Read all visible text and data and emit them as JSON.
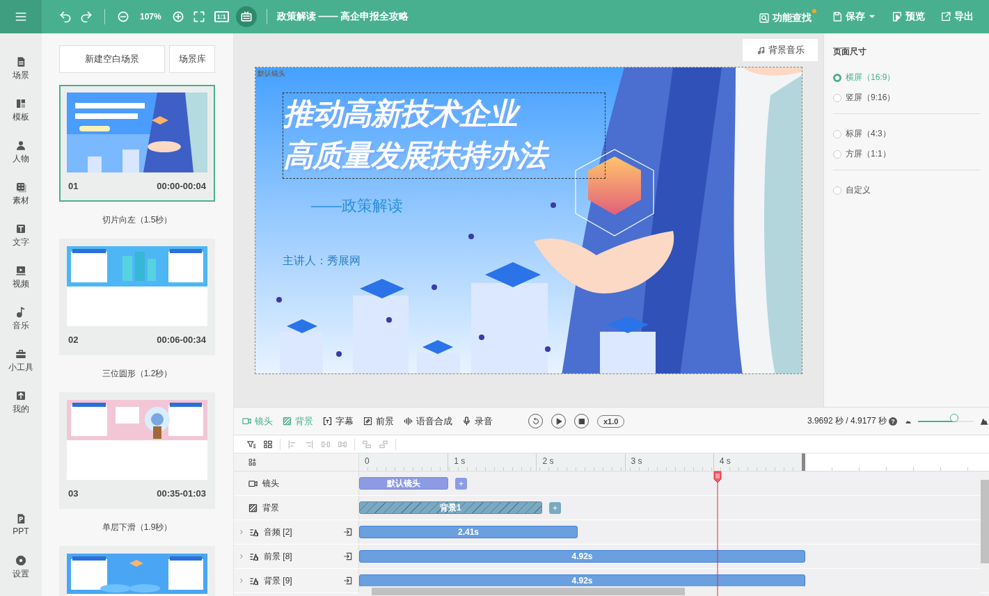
{
  "top_bar": {
    "zoom": "107%",
    "actual_size": "1:1",
    "caption_tool_on": true,
    "title": "政策解读 —— 高企申报全攻略",
    "actions": [
      {
        "label": "功能查找",
        "badge": true,
        "dropdown": false
      },
      {
        "label": "保存",
        "badge": false,
        "dropdown": true
      },
      {
        "label": "预览",
        "badge": false,
        "dropdown": false
      },
      {
        "label": "导出",
        "badge": false,
        "dropdown": false
      }
    ]
  },
  "nav": {
    "items": [
      {
        "label": "场景"
      },
      {
        "label": "模板"
      },
      {
        "label": "人物"
      },
      {
        "label": "素材"
      },
      {
        "label": "文字"
      },
      {
        "label": "视频"
      },
      {
        "label": "音乐"
      },
      {
        "label": "小工具"
      },
      {
        "label": "我的"
      }
    ],
    "footer_items": [
      {
        "label": "PPT"
      },
      {
        "label": "设置"
      }
    ]
  },
  "scenes": {
    "buttons": [
      "新建空白场景",
      "场景库"
    ],
    "items": [
      {
        "number": "01",
        "time": "00:00-00:04",
        "selected": true,
        "transition": "切片向左（1.5秒）"
      },
      {
        "number": "02",
        "time": "00:06-00:34",
        "selected": false,
        "transition": "三位圆形（1.2秒）"
      },
      {
        "number": "03",
        "time": "00:35-01:03",
        "selected": false,
        "transition": "单层下滑（1.9秒）"
      },
      {
        "selected": false
      }
    ]
  },
  "canvas": {
    "music_button": "背景音乐",
    "camera_tag": "默认镜头",
    "slide": {
      "title_lines": [
        "推动高新技术企业",
        "高质量发展扶持办法"
      ],
      "title_selected": true,
      "subtitle": "——政策解读",
      "presenter": "主讲人：秀展网"
    }
  },
  "page_size": {
    "title": "页面尺寸",
    "groups": [
      {
        "options": [
          {
            "label": "横屏（16:9）",
            "selected": true
          },
          {
            "label": "竖屏（9:16）",
            "selected": false
          }
        ]
      },
      {
        "options": [
          {
            "label": "标屏（4:3）",
            "selected": false
          },
          {
            "label": "方屏（1:1）",
            "selected": false
          }
        ]
      },
      {
        "options": [
          {
            "label": "自定义",
            "selected": false
          }
        ]
      }
    ]
  },
  "timeline": {
    "tabs": [
      {
        "label": "镜头",
        "on": true
      },
      {
        "label": "背景",
        "on": true
      },
      {
        "label": "字幕",
        "on": false
      },
      {
        "label": "前景",
        "on": false
      },
      {
        "label": "语音合成",
        "on": false
      },
      {
        "label": "录音",
        "on": false
      }
    ],
    "speed": "x1.0",
    "time": "3.9692 秒 / 4.9177 秒",
    "help": "?",
    "zoom": {
      "level": 0.65
    },
    "ruler": [
      "0",
      "1 s",
      "2 s",
      "3 s",
      "4 s"
    ],
    "tracks": [
      {
        "kind": "camera",
        "label": "镜头",
        "addable": true,
        "clip": {
          "label": "默认镜头",
          "level": 0.2
        }
      },
      {
        "kind": "background",
        "label": "背景",
        "addable": true,
        "clip": {
          "label": "背景1",
          "level": 0.41
        }
      },
      {
        "kind": "group",
        "label": "音频 [2]",
        "addable": false,
        "clip": {
          "label": "2.41s",
          "level": 0.49
        }
      },
      {
        "kind": "group",
        "label": "前景 [8]",
        "addable": false,
        "clip": {
          "label": "4.92s",
          "level": 1.0
        }
      },
      {
        "kind": "group",
        "label": "背景 [9]",
        "addable": false,
        "clip": {
          "label": "4.92s",
          "level": 1.0
        }
      }
    ]
  }
}
